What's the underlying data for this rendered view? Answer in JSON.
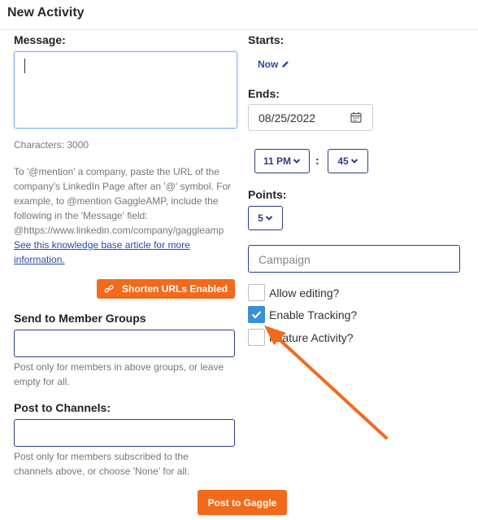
{
  "header": {
    "title": "New Activity"
  },
  "message": {
    "label": "Message:",
    "characters": "Characters: 3000",
    "help_lines": [
      "To '@mention' a company, paste the URL of the",
      "company's LinkedIn Page after an '@' symbol. For",
      "example, to @mention GaggleAMP, include the",
      "following in the 'Message' field:",
      "@https://www.linkedin.com/company/gaggleamp"
    ],
    "kb_link_lines": [
      "See this knowledge base article for more",
      "information."
    ],
    "shorten_button": "Shorten URLs Enabled",
    "shorten_icon": "link-icon"
  },
  "groups": {
    "label": "Send to Member Groups",
    "help_lines": [
      "Post only for members in above groups, or leave",
      "empty for all."
    ]
  },
  "channels": {
    "label": "Post to Channels:",
    "help_lines": [
      "Post only for members subscribed to the",
      "channels above, or choose 'None' for all."
    ]
  },
  "post_button": "Post to Gaggle",
  "starts": {
    "label": "Starts:",
    "value": "Now",
    "icon": "pencil-icon"
  },
  "ends": {
    "label": "Ends:",
    "date": "08/25/2022",
    "hour": "11 PM",
    "separator": ":",
    "minute": "45"
  },
  "points": {
    "label": "Points:",
    "value": "5"
  },
  "campaign": {
    "placeholder": "Campaign"
  },
  "options": [
    {
      "label": "Allow editing?",
      "checked": false
    },
    {
      "label": "Enable Tracking?",
      "checked": true
    },
    {
      "label": "Feature Activity?",
      "checked": false
    }
  ],
  "colors": {
    "accent": "#f26a1b",
    "navy": "#2e3d80",
    "check_blue": "#3a8fd6",
    "link": "#2a4aa8"
  }
}
